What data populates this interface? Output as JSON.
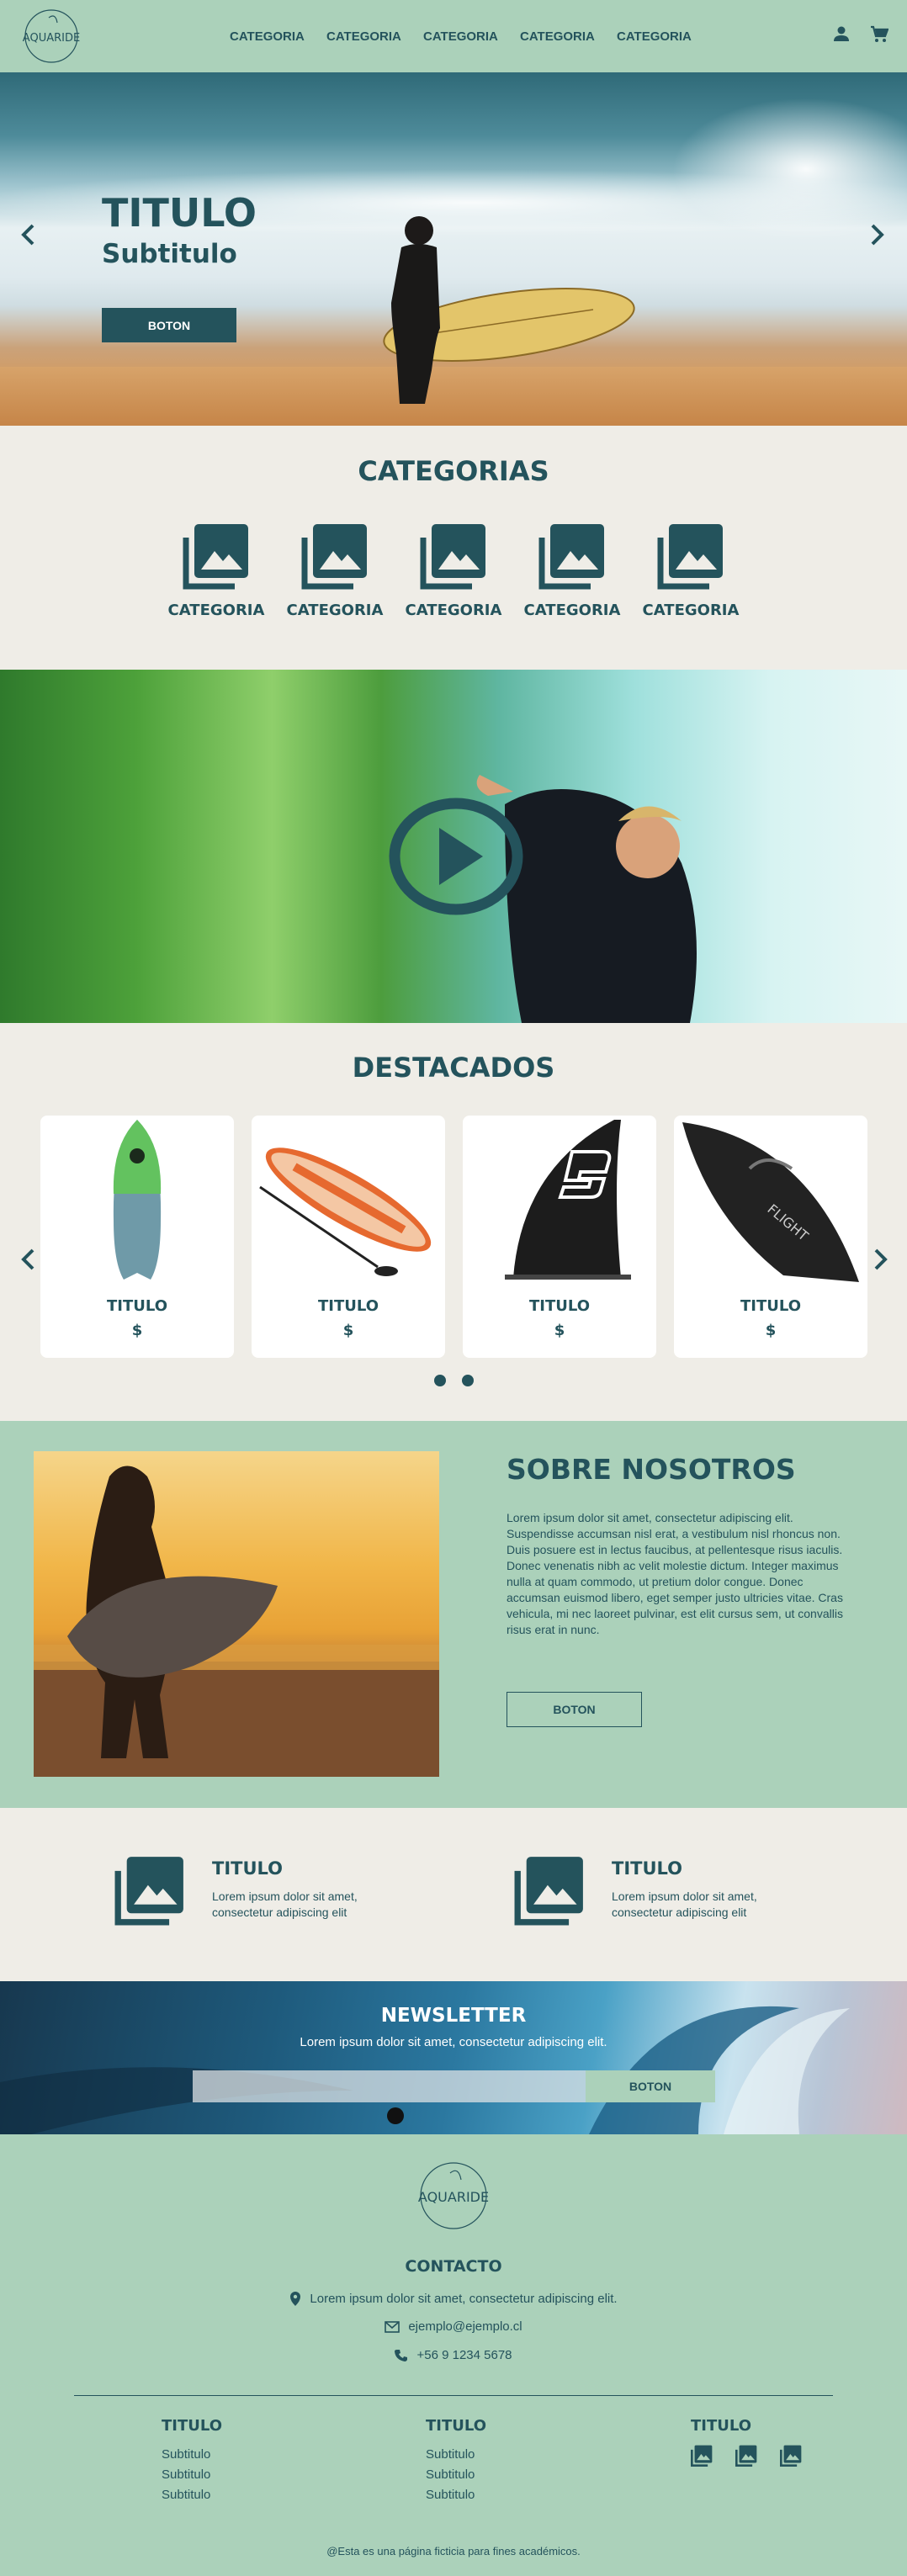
{
  "header": {
    "logo_text": "AQUARIDE",
    "nav": [
      "CATEGORIA",
      "CATEGORIA",
      "CATEGORIA",
      "CATEGORIA",
      "CATEGORIA"
    ],
    "icons": [
      "user-icon",
      "cart-icon"
    ]
  },
  "hero": {
    "title": "TITULO",
    "subtitle": "Subtitulo",
    "button": "BOTON"
  },
  "categories": {
    "title": "CATEGORIAS",
    "items": [
      "CATEGORIA",
      "CATEGORIA",
      "CATEGORIA",
      "CATEGORIA",
      "CATEGORIA"
    ]
  },
  "featured": {
    "title": "DESTACADOS",
    "products": [
      {
        "title": "TITULO",
        "price": "$"
      },
      {
        "title": "TITULO",
        "price": "$"
      },
      {
        "title": "TITULO",
        "price": "$"
      },
      {
        "title": "TITULO",
        "price": "$"
      }
    ]
  },
  "about": {
    "title": "SOBRE NOSOTROS",
    "text": "Lorem ipsum dolor sit amet, consectetur adipiscing elit. Suspendisse accumsan nisl erat, a vestibulum nisl rhoncus non. Duis posuere est in lectus faucibus, at pellentesque risus iaculis. Donec venenatis nibh ac velit molestie dictum. Integer maximus nulla at quam commodo, ut pretium dolor congue. Donec accumsan euismod libero, eget semper justo ultricies vitae. Cras vehicula, mi nec laoreet pulvinar, est elit cursus sem, ut convallis risus erat in nunc.",
    "button": "BOTON"
  },
  "info": [
    {
      "title": "TITULO",
      "text": "Lorem ipsum dolor sit amet, consectetur adipiscing elit"
    },
    {
      "title": "TITULO",
      "text": "Lorem ipsum dolor sit amet, consectetur adipiscing elit"
    }
  ],
  "newsletter": {
    "title": "NEWSLETTER",
    "subtitle": "Lorem ipsum dolor sit amet, consectetur adipiscing elit.",
    "input_placeholder": "",
    "button": "BOTON"
  },
  "footer": {
    "logo_text": "AQUARIDE",
    "contact_title": "CONTACTO",
    "address": "Lorem ipsum dolor sit amet, consectetur adipiscing elit.",
    "email": "ejemplo@ejemplo.cl",
    "phone": "+56 9 1234 5678",
    "col1": {
      "title": "TITULO",
      "items": [
        "Subtitulo",
        "Subtitulo",
        "Subtitulo"
      ]
    },
    "col2": {
      "title": "TITULO",
      "items": [
        "Subtitulo",
        "Subtitulo",
        "Subtitulo"
      ]
    },
    "col3": {
      "title": "TITULO"
    },
    "copyright": "@Esta es una página ficticia para fines académicos."
  },
  "colors": {
    "primary": "#24535c",
    "mint": "#abd1ba",
    "cream": "#efede7"
  }
}
